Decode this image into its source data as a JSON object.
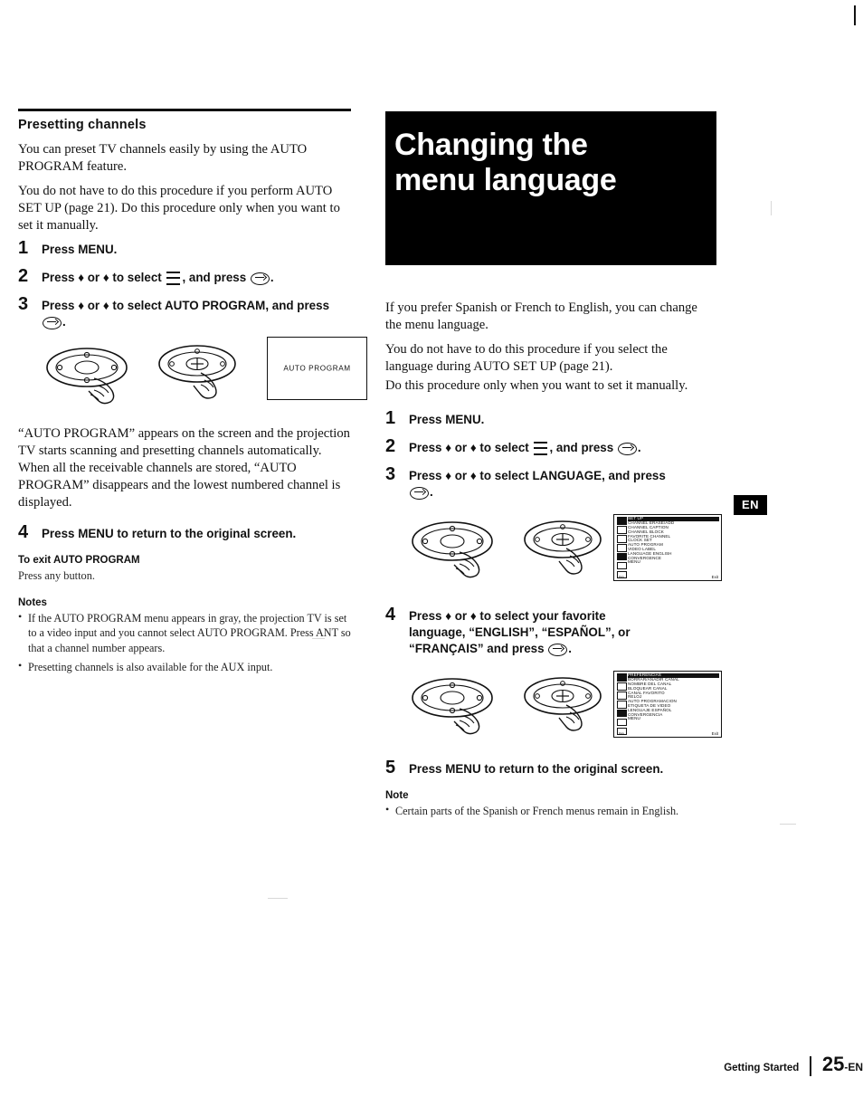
{
  "page": {
    "footer_section": "Getting Started",
    "page_number": "25",
    "page_suffix": "-EN",
    "lang_tab": "EN"
  },
  "left": {
    "title": "Presetting channels",
    "intro1": "You can preset TV channels easily by using the AUTO PROGRAM feature.",
    "intro2": "You do not have to do this procedure if you perform AUTO SET UP (page 21). Do this procedure only when you want to set it manually.",
    "steps": [
      {
        "num": "1",
        "text": "Press MENU."
      },
      {
        "num": "2",
        "text_before": "Press ♦ or ♦ to select",
        "text_after": ", and press",
        "text_end": "."
      },
      {
        "num": "3",
        "text": "Press ♦ or ♦ to select AUTO PROGRAM, and press",
        "text_end": "."
      }
    ],
    "osd_box_label": "AUTO  PROGRAM",
    "after_text": "“AUTO PROGRAM” appears on the screen and the projection TV starts scanning and presetting channels automatically. When all the receivable channels are stored, “AUTO PROGRAM” disappears and the lowest numbered channel is displayed.",
    "step4": {
      "num": "4",
      "text": "Press MENU to return to the original screen."
    },
    "exit_heading": "To exit AUTO PROGRAM",
    "exit_text": "Press any button.",
    "notes_heading": "Notes",
    "notes": [
      "If the AUTO PROGRAM menu appears in gray, the projection TV is set to a video input and you cannot select AUTO PROGRAM. Press ANT so that a channel number appears.",
      "Presetting channels is also available for the AUX input."
    ]
  },
  "right": {
    "title_line1": "Changing the",
    "title_line2": "menu language",
    "intro1": "If you prefer Spanish or French to English, you can change the menu language.",
    "intro2": "You do not have to do this procedure if you select the language during AUTO SET UP (page 21).",
    "intro3": "Do this procedure only when you want to set it manually.",
    "steps": [
      {
        "num": "1",
        "text": "Press MENU."
      },
      {
        "num": "2",
        "text_before": "Press ♦ or ♦ to select",
        "text_after": ", and press",
        "text_end": "."
      },
      {
        "num": "3",
        "text": "Press ♦ or ♦ to select LANGUAGE, and press",
        "text_end": "."
      },
      {
        "num": "4",
        "text_a": "Press ♦ or ♦ to select your favorite",
        "text_b": "language, “ENGLISH”, “ESPAÑOL”, or",
        "text_c": "“FRANÇAIS” and press",
        "text_end": "."
      },
      {
        "num": "5",
        "text": "Press MENU to return to the original screen."
      }
    ],
    "osd_english": {
      "header": "SET  UP",
      "rows": [
        "CHANNEL ERASE/ADD",
        "CHANNEL CAPTION",
        "CHANNEL BLOCK",
        "FAVORITE CHANNEL",
        "CLOCK SET",
        "AUTO PROGRAM",
        "VIDEO LABEL",
        "LANGUAGE   ENGLISH",
        "CONVERGENCE",
        "MENU"
      ],
      "foot_left": "Use",
      "foot_right": "Exit"
    },
    "osd_spanish": {
      "header": "PREFERENCIAS",
      "rows": [
        "BORRAR/AÑADIR CANAL",
        "NOMBRE DEL CANAL",
        "BLOQUEAR CANAL",
        "CANAL FAVORITO",
        "RELOJ",
        "AUTO PROGRAMACION",
        "ETIQUETA DE VIDEO",
        "LENGUAJE  ESPAÑOL",
        "CONVERGENCIA",
        "MENU"
      ],
      "foot_left": "Use",
      "foot_right": "Exit"
    },
    "note_heading": "Note",
    "note_text": "Certain parts of the Spanish or French menus remain in English."
  }
}
